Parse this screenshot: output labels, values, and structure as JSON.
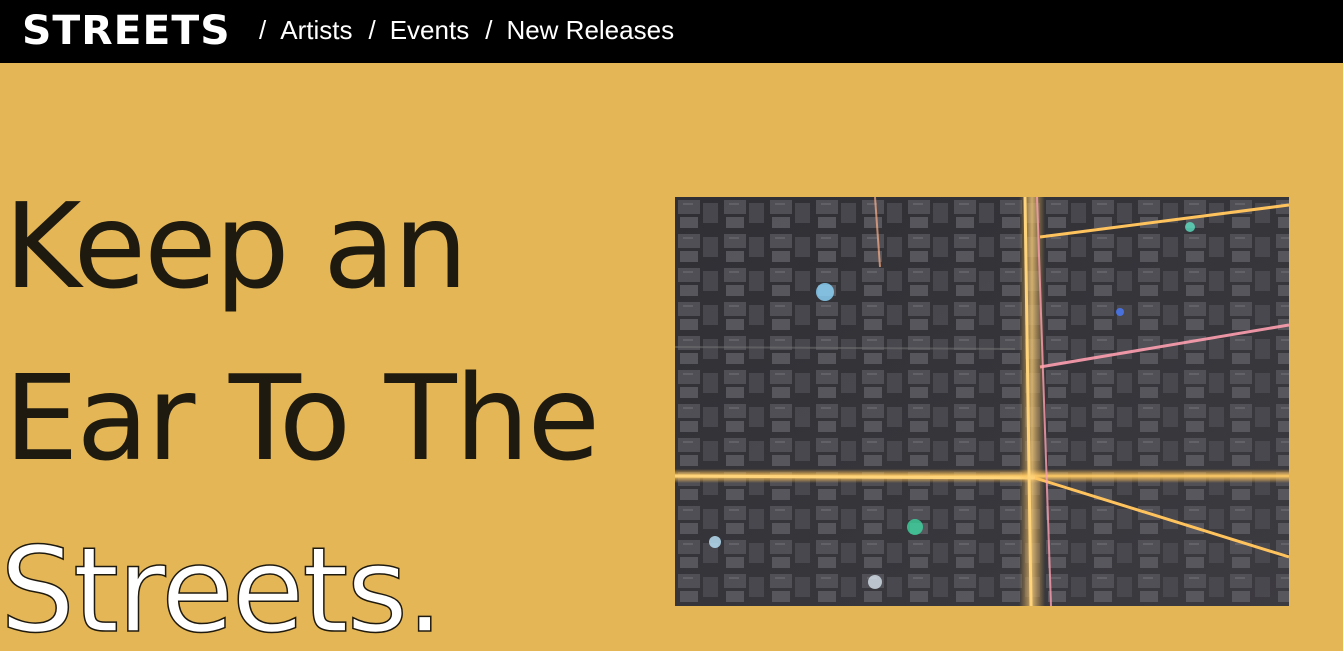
{
  "header": {
    "logo": "STREETS",
    "nav": [
      {
        "sep": "/",
        "label": "Artists"
      },
      {
        "sep": "/",
        "label": "Events"
      },
      {
        "sep": "/",
        "label": "New Releases"
      }
    ]
  },
  "hero": {
    "line1": "Keep an",
    "line2": "Ear To The",
    "line3": "Streets.",
    "image_subject": "aerial-night-city-streets-image"
  },
  "colors": {
    "background": "#e4b655",
    "topbar": "#000000",
    "headline": "#1f1a10",
    "accent_text": "#ffffff"
  }
}
